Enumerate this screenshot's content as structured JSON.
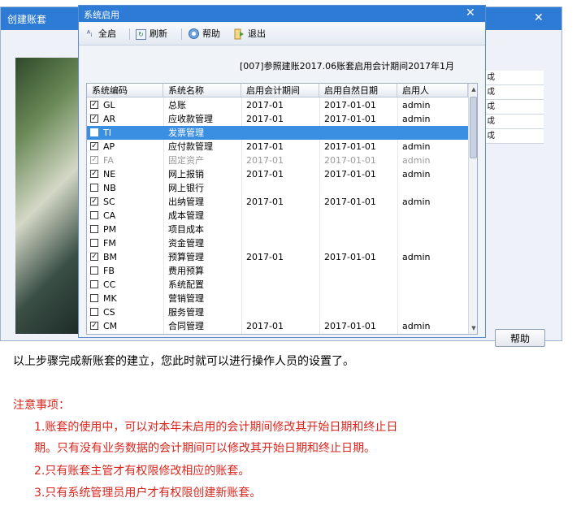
{
  "back_window": {
    "title": "创建账套",
    "close_glyph": "✕",
    "right_rows": [
      "戉",
      "戉",
      "戉",
      "戉",
      "戉"
    ],
    "help_label": "帮助"
  },
  "dialog": {
    "title": "系统启用",
    "close_glyph": "✕",
    "toolbar": [
      {
        "label": "全启",
        "icon": "enable-all-icon"
      },
      {
        "label": "刷新",
        "icon": "refresh-icon"
      },
      {
        "label": "帮助",
        "icon": "help-icon"
      },
      {
        "label": "退出",
        "icon": "exit-icon"
      }
    ],
    "info": "[007]参照建账2017.06账套启用会计期间2017年1月",
    "columns": [
      "系统编码",
      "系统名称",
      "启用会计期间",
      "启用自然日期",
      "启用人"
    ],
    "rows": [
      {
        "code": "GL",
        "name": "总账",
        "period": "2017-01",
        "date": "2017-01-01",
        "user": "admin",
        "checked": true,
        "selected": false,
        "disabled": false
      },
      {
        "code": "AR",
        "name": "应收款管理",
        "period": "2017-01",
        "date": "2017-01-01",
        "user": "admin",
        "checked": true,
        "selected": false,
        "disabled": false
      },
      {
        "code": "TI",
        "name": "发票管理",
        "period": "",
        "date": "",
        "user": "",
        "checked": false,
        "selected": true,
        "disabled": false
      },
      {
        "code": "AP",
        "name": "应付款管理",
        "period": "2017-01",
        "date": "2017-01-01",
        "user": "admin",
        "checked": true,
        "selected": false,
        "disabled": false
      },
      {
        "code": "FA",
        "name": "固定资产",
        "period": "2017-01",
        "date": "2017-01-01",
        "user": "admin",
        "checked": true,
        "selected": false,
        "disabled": true
      },
      {
        "code": "NE",
        "name": "网上报销",
        "period": "2017-01",
        "date": "2017-01-01",
        "user": "admin",
        "checked": true,
        "selected": false,
        "disabled": false
      },
      {
        "code": "NB",
        "name": "网上银行",
        "period": "",
        "date": "",
        "user": "",
        "checked": false,
        "selected": false,
        "disabled": false
      },
      {
        "code": "SC",
        "name": "出纳管理",
        "period": "2017-01",
        "date": "2017-01-01",
        "user": "admin",
        "checked": true,
        "selected": false,
        "disabled": false
      },
      {
        "code": "CA",
        "name": "成本管理",
        "period": "",
        "date": "",
        "user": "",
        "checked": false,
        "selected": false,
        "disabled": false
      },
      {
        "code": "PM",
        "name": "项目成本",
        "period": "",
        "date": "",
        "user": "",
        "checked": false,
        "selected": false,
        "disabled": false
      },
      {
        "code": "FM",
        "name": "资金管理",
        "period": "",
        "date": "",
        "user": "",
        "checked": false,
        "selected": false,
        "disabled": false
      },
      {
        "code": "BM",
        "name": "预算管理",
        "period": "2017-01",
        "date": "2017-01-01",
        "user": "admin",
        "checked": true,
        "selected": false,
        "disabled": false
      },
      {
        "code": "FB",
        "name": "费用预算",
        "period": "",
        "date": "",
        "user": "",
        "checked": false,
        "selected": false,
        "disabled": false
      },
      {
        "code": "CC",
        "name": "系统配置",
        "period": "",
        "date": "",
        "user": "",
        "checked": false,
        "selected": false,
        "disabled": false
      },
      {
        "code": "MK",
        "name": "营销管理",
        "period": "",
        "date": "",
        "user": "",
        "checked": false,
        "selected": false,
        "disabled": false
      },
      {
        "code": "CS",
        "name": "服务管理",
        "period": "",
        "date": "",
        "user": "",
        "checked": false,
        "selected": false,
        "disabled": false
      },
      {
        "code": "CM",
        "name": "合同管理",
        "period": "2017-01",
        "date": "2017-01-01",
        "user": "admin",
        "checked": true,
        "selected": false,
        "disabled": false
      }
    ],
    "selection_color": "#3b8fe3"
  },
  "body_text": "以上步骤完成新账套的建立，您此时就可以进行操作人员的设置了。",
  "notes": {
    "heading": "注意事项：",
    "lines": [
      "1.账套的使用中，可以对本年未启用的会计期间修改其开始日期和终止日",
      "期。只有没有业务数据的会计期间可以修改其开始日期和终止日期。",
      "2.只有账套主管才有权限修改相应的账套。",
      "3.只有系统管理员用户才有权限创建新账套。"
    ],
    "color": "#d9251d"
  }
}
